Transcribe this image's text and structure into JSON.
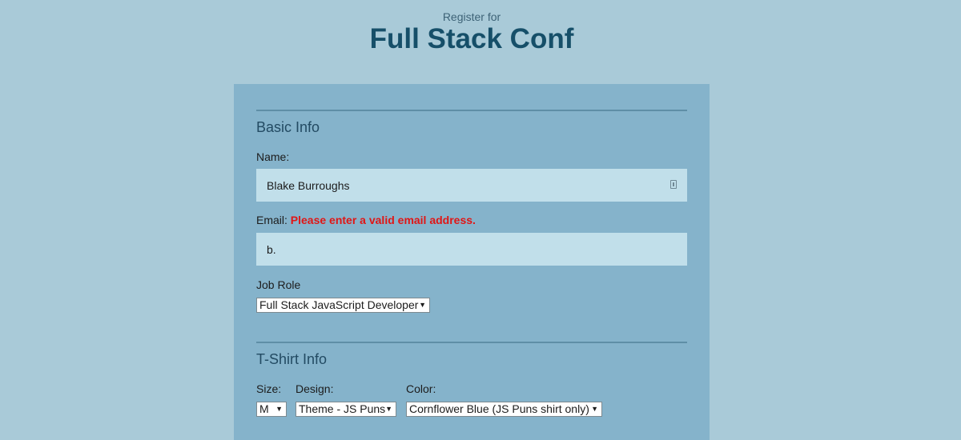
{
  "header": {
    "subtitle": "Register for",
    "title": "Full Stack Conf"
  },
  "basic_info": {
    "section_title": "Basic Info",
    "name_label": "Name:",
    "name_value": "Blake Burroughs",
    "email_label": "Email:",
    "email_error": "Please enter a valid email address.",
    "email_value": "b.",
    "job_role_label": "Job Role",
    "job_role_selected": "Full Stack JavaScript Developer"
  },
  "tshirt_info": {
    "section_title": "T-Shirt Info",
    "size_label": "Size:",
    "size_selected": "M",
    "design_label": "Design:",
    "design_selected": "Theme - JS Puns",
    "color_label": "Color:",
    "color_selected": "Cornflower Blue (JS Puns shirt only)"
  },
  "icons": {
    "dropdown_arrow": "▼"
  },
  "colors": {
    "page_background": "#a9cad8",
    "panel_background": "#85b3cb",
    "input_background": "#c1dfea",
    "title_color": "#164f69",
    "error_color": "#e01616"
  }
}
